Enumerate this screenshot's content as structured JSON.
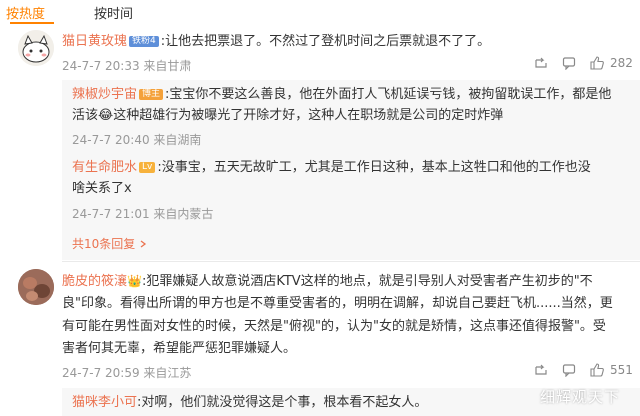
{
  "tabs": [
    {
      "label": "按热度",
      "active": true
    },
    {
      "label": "按时间",
      "active": false
    }
  ],
  "comment1": {
    "author": "猫日黄玫瑰",
    "badge": "铁粉4",
    "text": ":让他去把票退了。不然过了登机时间之后票就退不了了。",
    "meta": "24-7-7 20:33 来自甘肃",
    "likes": "282",
    "replies": [
      {
        "author": "辣椒炒宇宙",
        "badge": "博主",
        "lines": [
          ":宝宝你不要这么善良，他在外面打人飞机延误亏钱，被拘留耽误工作，都是他",
          "活该😂这种超雄行为被曝光了开除才好，这种人在职场就是公司的定时炸弹"
        ],
        "meta": "24-7-7 20:40 来自湖南"
      },
      {
        "author": "有生命肥水",
        "badge": "Lv",
        "lines": [
          ":没事宝，五天无故旷工，尤其是工作日这种，基本上这牲口和他的工作也没",
          "啥关系了x"
        ],
        "meta": "24-7-7 21:01 来自内蒙古"
      }
    ],
    "more_replies": "共10条回复"
  },
  "comment2": {
    "author": "脆皮的筱瀼",
    "lines": [
      ":犯罪嫌疑人故意说酒店KTV这样的地点，就是引导别人对受害者产生初步的\"不",
      "良\"印象。看得出所谓的甲方也是不尊重受害者的，明明在调解，却说自己要赶飞机......当然，更",
      "有可能在男性面对女性的时候，天然是\"俯视\"的，认为\"女的就是矫情，这点事还值得报警\"。受",
      "害者何其无辜，希望能严惩犯罪嫌疑人。"
    ],
    "meta": "24-7-7 20:59 来自江苏",
    "likes": "551",
    "reply": {
      "author": "猫咪李小可",
      "text": ":对啊，他们就没觉得这是个事，根本看不起女人。"
    }
  },
  "watermark": "细辉观天下",
  "colors": {
    "accent": "#ff8200",
    "name": "#eb7350",
    "meta": "#999999",
    "reply_bg": "#f7f7f7"
  }
}
